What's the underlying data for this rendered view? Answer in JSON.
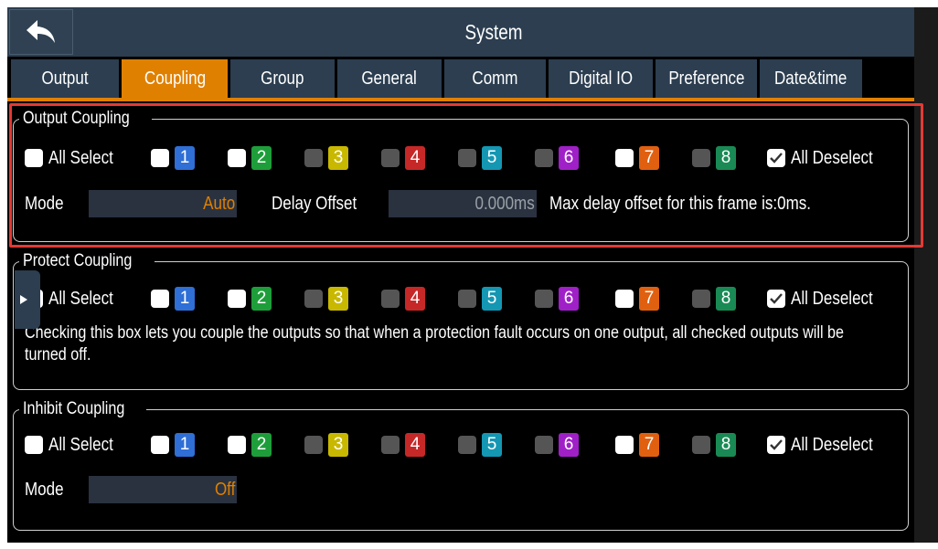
{
  "title": "System",
  "tabs": [
    {
      "label": "Output",
      "active": false
    },
    {
      "label": "Coupling",
      "active": true
    },
    {
      "label": "Group",
      "active": false
    },
    {
      "label": "General",
      "active": false
    },
    {
      "label": "Comm",
      "active": false
    },
    {
      "label": "Digital IO",
      "active": false
    },
    {
      "label": "Preference",
      "active": false
    },
    {
      "label": "Date&time",
      "active": false
    }
  ],
  "common": {
    "all_select": "All Select",
    "all_deselect": "All Deselect",
    "channel_labels": [
      "1",
      "2",
      "3",
      "4",
      "5",
      "6",
      "7",
      "8"
    ],
    "channel_colors": [
      "#2f6fd6",
      "#1e9e3a",
      "#c9b800",
      "#c62828",
      "#1497b3",
      "#a020c8",
      "#e06010",
      "#1a8a55"
    ]
  },
  "output_coupling": {
    "legend": "Output Coupling",
    "all_select_checked": false,
    "channel_checked": [
      true,
      true,
      false,
      false,
      false,
      false,
      true,
      false
    ],
    "all_deselect_checked": true,
    "mode_label": "Mode",
    "mode_value": "Auto",
    "delay_label": "Delay Offset",
    "delay_value": "0.000ms",
    "max_delay_text": "Max delay offset for this frame is:0ms."
  },
  "protect_coupling": {
    "legend": "Protect Coupling",
    "all_select_checked": false,
    "channel_checked": [
      true,
      true,
      false,
      false,
      false,
      false,
      true,
      false
    ],
    "all_deselect_checked": true,
    "description": "Checking this box lets you couple the outputs so that when a protection fault occurs on one output, all checked outputs will be turned off."
  },
  "inhibit_coupling": {
    "legend": "Inhibit Coupling",
    "all_select_checked": false,
    "channel_checked": [
      true,
      true,
      false,
      false,
      false,
      false,
      true,
      false
    ],
    "all_deselect_checked": true,
    "mode_label": "Mode",
    "mode_value": "Off"
  },
  "colors": {
    "accent": "#e08000",
    "panel": "#2c3e50",
    "highlight": "#e53935"
  }
}
